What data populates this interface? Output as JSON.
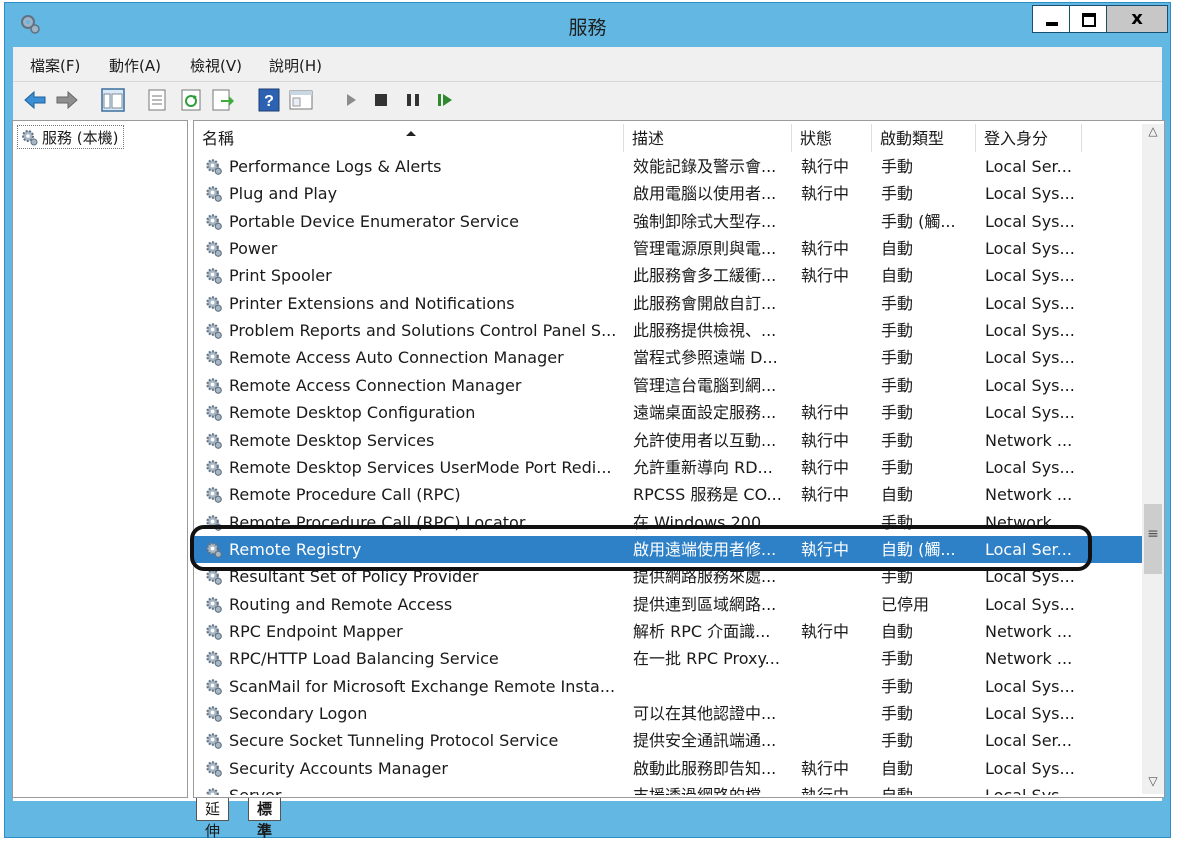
{
  "window": {
    "title": "服務"
  },
  "title_controls": {
    "close_glyph": "x"
  },
  "menu": [
    {
      "label": "檔案(F)"
    },
    {
      "label": "動作(A)"
    },
    {
      "label": "檢視(V)"
    },
    {
      "label": "說明(H)"
    }
  ],
  "toolbar": [
    {
      "icon": "back-arrow-icon"
    },
    {
      "icon": "forward-arrow-icon"
    },
    {
      "icon": "show-tree-icon"
    },
    {
      "icon": "properties-icon"
    },
    {
      "icon": "refresh-icon"
    },
    {
      "icon": "export-list-icon"
    },
    {
      "icon": "help-icon"
    },
    {
      "icon": "console-view-icon"
    },
    {
      "icon": "start-service-icon"
    },
    {
      "icon": "stop-service-icon"
    },
    {
      "icon": "pause-service-icon"
    },
    {
      "icon": "resume-service-icon"
    }
  ],
  "tree": {
    "root_label": "服務 (本機)"
  },
  "columns": {
    "name": "名稱",
    "description": "描述",
    "status": "狀態",
    "startup_type": "啟動類型",
    "log_on_as": "登入身分"
  },
  "services": [
    {
      "name": "Performance Logs & Alerts",
      "description": "效能記錄及警示會...",
      "status": "執行中",
      "startup": "手動",
      "logon": "Local Ser..."
    },
    {
      "name": "Plug and Play",
      "description": "啟用電腦以使用者...",
      "status": "執行中",
      "startup": "手動",
      "logon": "Local Sys..."
    },
    {
      "name": "Portable Device Enumerator Service",
      "description": "強制卸除式大型存...",
      "status": "",
      "startup": "手動 (觸...",
      "logon": "Local Sys..."
    },
    {
      "name": "Power",
      "description": "管理電源原則與電...",
      "status": "執行中",
      "startup": "自動",
      "logon": "Local Sys..."
    },
    {
      "name": "Print Spooler",
      "description": "此服務會多工緩衝...",
      "status": "執行中",
      "startup": "自動",
      "logon": "Local Sys..."
    },
    {
      "name": "Printer Extensions and Notifications",
      "description": "此服務會開啟自訂...",
      "status": "",
      "startup": "手動",
      "logon": "Local Sys..."
    },
    {
      "name": "Problem Reports and Solutions Control Panel S...",
      "description": "此服務提供檢視、...",
      "status": "",
      "startup": "手動",
      "logon": "Local Sys..."
    },
    {
      "name": "Remote Access Auto Connection Manager",
      "description": "當程式參照遠端 D...",
      "status": "",
      "startup": "手動",
      "logon": "Local Sys..."
    },
    {
      "name": "Remote Access Connection Manager",
      "description": "管理這台電腦到網...",
      "status": "",
      "startup": "手動",
      "logon": "Local Sys..."
    },
    {
      "name": "Remote Desktop Configuration",
      "description": "遠端桌面設定服務...",
      "status": "執行中",
      "startup": "手動",
      "logon": "Local Sys..."
    },
    {
      "name": "Remote Desktop Services",
      "description": "允許使用者以互動...",
      "status": "執行中",
      "startup": "手動",
      "logon": "Network ..."
    },
    {
      "name": "Remote Desktop Services UserMode Port Redi...",
      "description": "允許重新導向 RD...",
      "status": "執行中",
      "startup": "手動",
      "logon": "Local Sys..."
    },
    {
      "name": "Remote Procedure Call (RPC)",
      "description": "RPCSS 服務是 CO...",
      "status": "執行中",
      "startup": "自動",
      "logon": "Network ..."
    },
    {
      "name": "Remote Procedure Call (RPC) Locator",
      "description": "在 Windows 200...",
      "status": "",
      "startup": "手動",
      "logon": "Network ..."
    },
    {
      "name": "Remote Registry",
      "description": "啟用遠端使用者修...",
      "status": "執行中",
      "startup": "自動 (觸...",
      "logon": "Local Ser...",
      "selected": true
    },
    {
      "name": "Resultant Set of Policy Provider",
      "description": "提供網路服務來處...",
      "status": "",
      "startup": "手動",
      "logon": "Local Sys..."
    },
    {
      "name": "Routing and Remote Access",
      "description": "提供連到區域網路...",
      "status": "",
      "startup": "已停用",
      "logon": "Local Sys..."
    },
    {
      "name": "RPC Endpoint Mapper",
      "description": "解析 RPC 介面識...",
      "status": "執行中",
      "startup": "自動",
      "logon": "Network ..."
    },
    {
      "name": "RPC/HTTP Load Balancing Service",
      "description": "在一批 RPC Proxy...",
      "status": "",
      "startup": "手動",
      "logon": "Network ..."
    },
    {
      "name": "ScanMail for Microsoft Exchange Remote Insta...",
      "description": "",
      "status": "",
      "startup": "手動",
      "logon": "Local Sys..."
    },
    {
      "name": "Secondary Logon",
      "description": "可以在其他認證中...",
      "status": "",
      "startup": "手動",
      "logon": "Local Sys..."
    },
    {
      "name": "Secure Socket Tunneling Protocol Service",
      "description": "提供安全通訊端通...",
      "status": "",
      "startup": "手動",
      "logon": "Local Ser..."
    },
    {
      "name": "Security Accounts Manager",
      "description": "啟動此服務即告知...",
      "status": "執行中",
      "startup": "自動",
      "logon": "Local Sys..."
    },
    {
      "name": "Server",
      "description": "支援透過網路的檔...",
      "status": "執行中",
      "startup": "自動",
      "logon": "Local Sys..."
    }
  ],
  "tabs": [
    {
      "label": "延伸",
      "active": false
    },
    {
      "label": "標準",
      "active": true
    }
  ],
  "colors": {
    "titlebar": "#62b8e2",
    "selection": "#2e80c7",
    "highlight_ring": "#111111"
  }
}
